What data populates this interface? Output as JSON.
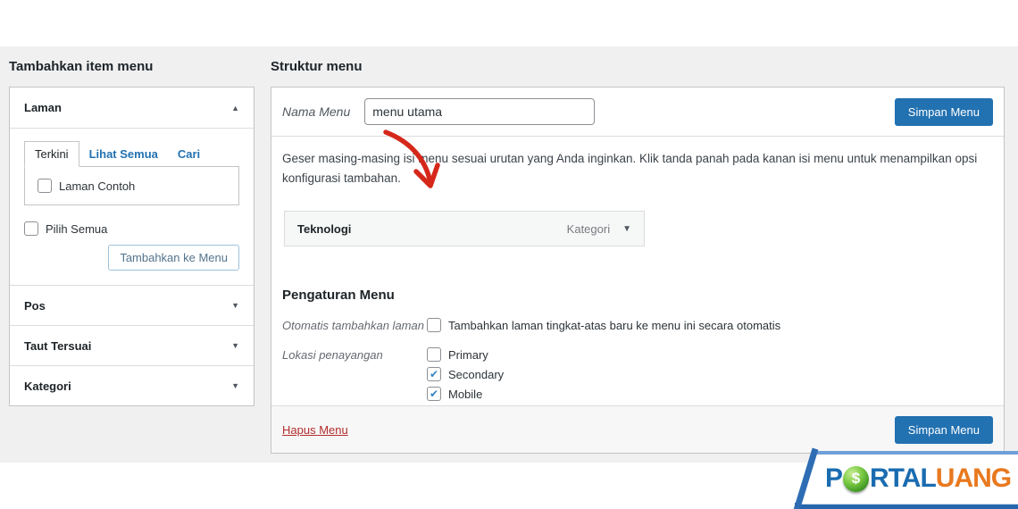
{
  "icons": {
    "collapse": "▲",
    "expand": "▼",
    "dropdown": "▼",
    "check": "✔"
  },
  "colors": {
    "accent_blue": "#2271b1",
    "delete_red": "#b32d2e",
    "arrow_red": "#d5281b",
    "admin_bg": "#f0f0f1",
    "logo_blue": "#1a6cb0",
    "logo_orange": "#e8791e",
    "coin_green": "#5cb832"
  },
  "left_panel": {
    "title": "Tambahkan item menu",
    "laman": {
      "label": "Laman",
      "tabs": [
        {
          "label": "Terkini",
          "active": true
        },
        {
          "label": "Lihat Semua",
          "active": false
        },
        {
          "label": "Cari",
          "active": false
        }
      ],
      "page_checkbox": {
        "label": "Laman Contoh",
        "checked": false
      },
      "select_all": {
        "label": "Pilih Semua",
        "checked": false
      },
      "add_button": "Tambahkan ke Menu"
    },
    "sections": [
      {
        "label": "Pos"
      },
      {
        "label": "Taut Tersuai"
      },
      {
        "label": "Kategori"
      }
    ]
  },
  "menu_structure": {
    "title": "Struktur menu",
    "name_label": "Nama Menu",
    "name_value": "menu utama",
    "save_button_top": "Simpan Menu",
    "description": "Geser masing-masing isi menu sesuai urutan yang Anda inginkan. Klik tanda panah pada kanan isi menu untuk menampilkan opsi konfigurasi tambahan.",
    "menu_item": {
      "title": "Teknologi",
      "type": "Kategori"
    },
    "settings": {
      "title": "Pengaturan Menu",
      "auto_add_label": "Otomatis tambahkan laman",
      "auto_add_option": "Tambahkan laman tingkat-atas baru ke menu ini secara otomatis",
      "auto_add_checked": false,
      "display_location_label": "Lokasi penayangan",
      "locations": [
        {
          "label": "Primary",
          "checked": false
        },
        {
          "label": "Secondary",
          "checked": true
        },
        {
          "label": "Mobile",
          "checked": true
        }
      ]
    },
    "delete_link": "Hapus Menu",
    "save_button_bottom": "Simpan Menu"
  },
  "logo": {
    "text_p": "P",
    "text_rtal": "RTAL",
    "text_uang": "UANG",
    "coin_symbol": "$"
  }
}
